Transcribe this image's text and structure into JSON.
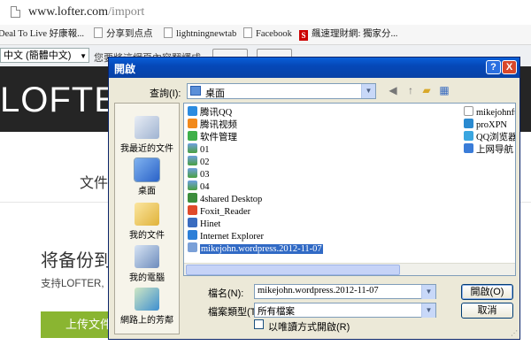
{
  "browser": {
    "url_host": "www.lofter.com",
    "url_path": "/import",
    "bookmarks": [
      {
        "label": "Deal To Live 好康報..."
      },
      {
        "label": "分享到点点"
      },
      {
        "label": "lightningnewtab"
      },
      {
        "label": "Facebook"
      },
      {
        "label": "飆速理財網: 獨家分..."
      }
    ],
    "translate": {
      "language": "中文 (簡體中文)",
      "faint_text": "您要將這網頁內容翻譯成..."
    }
  },
  "page": {
    "logo": "LOFTER",
    "tab": "文件",
    "restore_title": "将备份到",
    "support_text": "支持LOFTER,",
    "upload_button": "上传文件"
  },
  "dialog": {
    "title": "開啟",
    "look_in_label": "查詢(I):",
    "look_in_value": "桌面",
    "places": [
      {
        "label": "我最近的文件"
      },
      {
        "label": "桌面"
      },
      {
        "label": "我的文件"
      },
      {
        "label": "我的電腦"
      },
      {
        "label": "網路上的芳鄰"
      }
    ],
    "files_col1": [
      "腾讯QQ",
      "腾讯视频",
      "软件管理",
      "01",
      "02",
      "03",
      "04",
      "4shared Desktop",
      "Foxit_Reader",
      "Hinet",
      "Internet Explorer",
      "mikejohn.wordpress.2012-11-07"
    ],
    "files_col2": [
      "mikejohnft",
      "proXPN",
      "QQ浏览器",
      "上网导航"
    ],
    "filename_label": "檔名(N):",
    "filename_value": "mikejohn.wordpress.2012-11-07",
    "filetype_label": "檔案類型(T):",
    "filetype_value": "所有檔案",
    "readonly_label": "以唯讀方式開啟(R)",
    "open_button": "開啟(O)",
    "cancel_button": "取消",
    "help_glyph": "?",
    "close_glyph": "X"
  }
}
